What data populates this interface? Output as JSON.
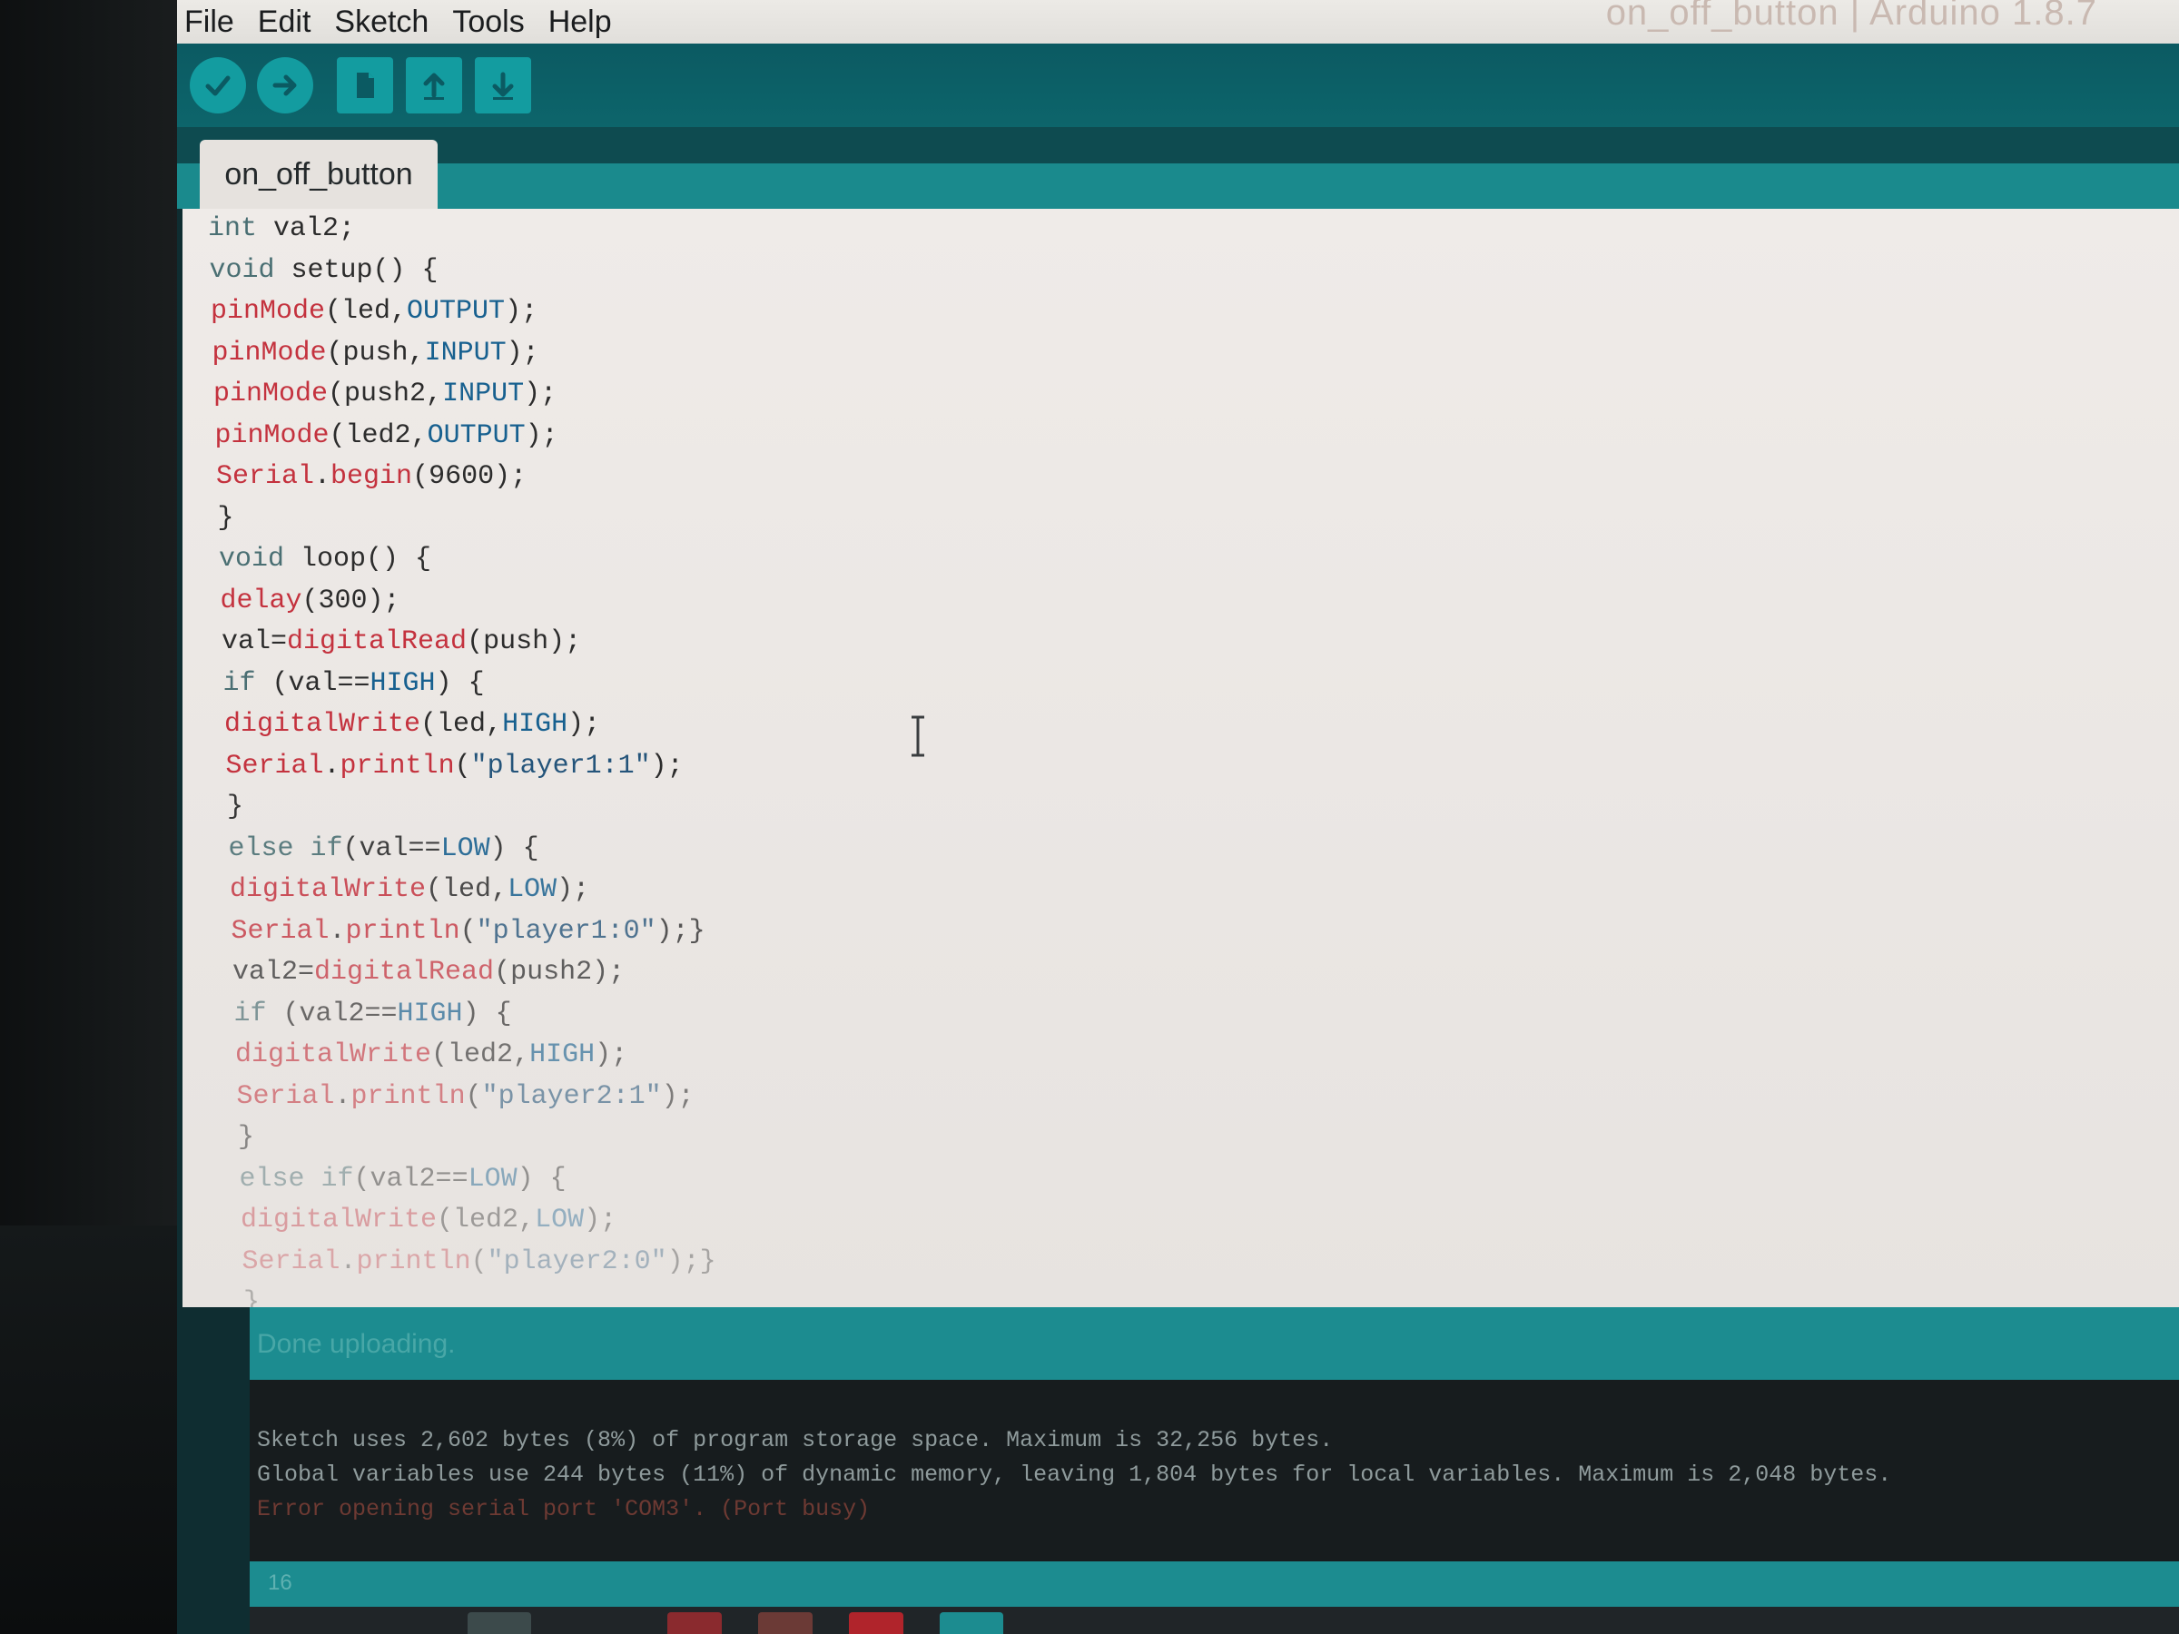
{
  "window": {
    "title": "on_off_button | Arduino 1.8.7"
  },
  "menu": [
    "File",
    "Edit",
    "Sketch",
    "Tools",
    "Help"
  ],
  "toolbar": {
    "buttons": [
      {
        "name": "verify",
        "icon": "check-icon"
      },
      {
        "name": "upload",
        "icon": "arrow-right-icon"
      },
      {
        "name": "new",
        "icon": "document-icon"
      },
      {
        "name": "open",
        "icon": "arrow-up-icon"
      },
      {
        "name": "save",
        "icon": "arrow-down-icon"
      }
    ]
  },
  "tabs": [
    {
      "label": "on_off_button",
      "active": true
    }
  ],
  "editor": {
    "lines": [
      [
        [
          "kw",
          "int"
        ],
        [
          "pl",
          " val2;"
        ]
      ],
      [
        [
          "kw",
          "void"
        ],
        [
          "pl",
          " setup() {"
        ]
      ],
      [
        [
          "fn",
          "pinMode"
        ],
        [
          "pl",
          "(led,"
        ],
        [
          "cn",
          "OUTPUT"
        ],
        [
          "pl",
          ");"
        ]
      ],
      [
        [
          "fn",
          "pinMode"
        ],
        [
          "pl",
          "(push,"
        ],
        [
          "cn",
          "INPUT"
        ],
        [
          "pl",
          ");"
        ]
      ],
      [
        [
          "fn",
          "pinMode"
        ],
        [
          "pl",
          "(push2,"
        ],
        [
          "cn",
          "INPUT"
        ],
        [
          "pl",
          ");"
        ]
      ],
      [
        [
          "fn",
          "pinMode"
        ],
        [
          "pl",
          "(led2,"
        ],
        [
          "cn",
          "OUTPUT"
        ],
        [
          "pl",
          ");"
        ]
      ],
      [
        [
          "fn",
          "Serial"
        ],
        [
          "pl",
          "."
        ],
        [
          "fn",
          "begin"
        ],
        [
          "pl",
          "(9600);"
        ]
      ],
      [
        [
          "pl",
          "}"
        ]
      ],
      [
        [
          "kw",
          "void"
        ],
        [
          "pl",
          " loop() {"
        ]
      ],
      [
        [
          "fn",
          "delay"
        ],
        [
          "pl",
          "(300);"
        ]
      ],
      [
        [
          "pl",
          "val="
        ],
        [
          "fn",
          "digitalRead"
        ],
        [
          "pl",
          "(push);"
        ]
      ],
      [
        [
          "kw",
          "if"
        ],
        [
          "pl",
          " (val=="
        ],
        [
          "cn",
          "HIGH"
        ],
        [
          "pl",
          ") {"
        ]
      ],
      [
        [
          "fn",
          "digitalWrite"
        ],
        [
          "pl",
          "(led,"
        ],
        [
          "cn",
          "HIGH"
        ],
        [
          "pl",
          ");"
        ]
      ],
      [
        [
          "fn",
          "Serial"
        ],
        [
          "pl",
          "."
        ],
        [
          "fn",
          "println"
        ],
        [
          "pl",
          "("
        ],
        [
          "st",
          "\"player1:1\""
        ],
        [
          "pl",
          ");"
        ]
      ],
      [
        [
          "pl",
          "}"
        ]
      ],
      [
        [
          "kw",
          "else"
        ],
        [
          "pl",
          " "
        ],
        [
          "kw",
          "if"
        ],
        [
          "pl",
          "(val=="
        ],
        [
          "cn",
          "LOW"
        ],
        [
          "pl",
          ") {"
        ]
      ],
      [
        [
          "fn",
          "digitalWrite"
        ],
        [
          "pl",
          "(led,"
        ],
        [
          "cn",
          "LOW"
        ],
        [
          "pl",
          ");"
        ]
      ],
      [
        [
          "fn",
          "Serial"
        ],
        [
          "pl",
          "."
        ],
        [
          "fn",
          "println"
        ],
        [
          "pl",
          "("
        ],
        [
          "st",
          "\"player1:0\""
        ],
        [
          "pl",
          ");}"
        ]
      ],
      [
        [
          "pl",
          "val2="
        ],
        [
          "fn",
          "digitalRead"
        ],
        [
          "pl",
          "(push2);"
        ]
      ],
      [
        [
          "kw",
          "if"
        ],
        [
          "pl",
          " (val2=="
        ],
        [
          "cn",
          "HIGH"
        ],
        [
          "pl",
          ") {"
        ]
      ],
      [
        [
          "fn",
          "digitalWrite"
        ],
        [
          "pl",
          "(led2,"
        ],
        [
          "cn",
          "HIGH"
        ],
        [
          "pl",
          ");"
        ]
      ],
      [
        [
          "fn",
          "Serial"
        ],
        [
          "pl",
          "."
        ],
        [
          "fn",
          "println"
        ],
        [
          "pl",
          "("
        ],
        [
          "st",
          "\"player2:1\""
        ],
        [
          "pl",
          ");"
        ]
      ],
      [
        [
          "pl",
          "}"
        ]
      ],
      [
        [
          "kw",
          "else"
        ],
        [
          "pl",
          " "
        ],
        [
          "kw",
          "if"
        ],
        [
          "pl",
          "(val2=="
        ],
        [
          "cn",
          "LOW"
        ],
        [
          "pl",
          ") {"
        ]
      ],
      [
        [
          "fn",
          "digitalWrite"
        ],
        [
          "pl",
          "(led2,"
        ],
        [
          "cn",
          "LOW"
        ],
        [
          "pl",
          ");"
        ]
      ],
      [
        [
          "fn",
          "Serial"
        ],
        [
          "pl",
          "."
        ],
        [
          "fn",
          "println"
        ],
        [
          "pl",
          "("
        ],
        [
          "st",
          "\"player2:0\""
        ],
        [
          "pl",
          ");}"
        ]
      ],
      [
        [
          "pl",
          "}"
        ]
      ]
    ]
  },
  "status": {
    "message": "Done uploading."
  },
  "console": {
    "lines": [
      {
        "text": "Sketch uses 2,602 bytes (8%) of program storage space. Maximum is 32,256 bytes.",
        "type": "info"
      },
      {
        "text": "Global variables use 244 bytes (11%) of dynamic memory, leaving 1,804 bytes for local variables. Maximum is 2,048 bytes.",
        "type": "info"
      },
      {
        "text": "Error opening serial port 'COM3'. (Port busy)",
        "type": "error"
      }
    ]
  },
  "footer": {
    "line_number": "16"
  },
  "colors": {
    "teal_dark": "#0e4b50",
    "teal": "#1c8c90",
    "button_teal": "#139ca0",
    "editor_bg": "#ebe7e4",
    "keyword": "#4a6f73",
    "function": "#c4323e",
    "constant": "#17608f",
    "string": "#24547a"
  }
}
